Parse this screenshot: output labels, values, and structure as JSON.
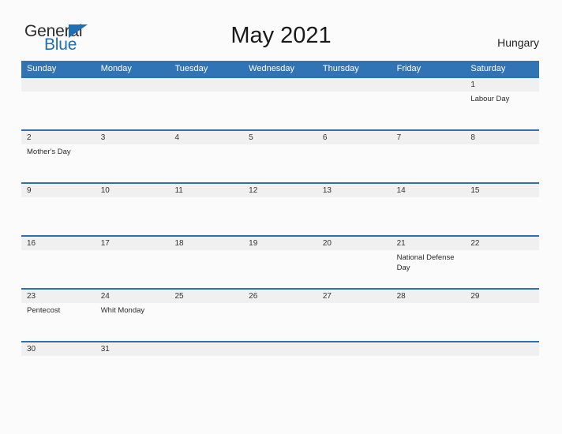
{
  "logo": {
    "word_one": "General",
    "word_two": "Blue",
    "triangle_color": "#1f6fb4"
  },
  "header": {
    "title": "May 2021",
    "country": "Hungary"
  },
  "theme": {
    "header_blue": "#3174b5",
    "row_rule_blue": "#2f6fae",
    "date_band_gray": "#f0f0f0",
    "page_background": "#fbfbfb"
  },
  "calendar": {
    "weekdays": [
      "Sunday",
      "Monday",
      "Tuesday",
      "Wednesday",
      "Thursday",
      "Friday",
      "Saturday"
    ],
    "weeks": [
      {
        "days": [
          {
            "date": "",
            "event": ""
          },
          {
            "date": "",
            "event": ""
          },
          {
            "date": "",
            "event": ""
          },
          {
            "date": "",
            "event": ""
          },
          {
            "date": "",
            "event": ""
          },
          {
            "date": "",
            "event": ""
          },
          {
            "date": "1",
            "event": "Labour Day"
          }
        ]
      },
      {
        "days": [
          {
            "date": "2",
            "event": "Mother's Day"
          },
          {
            "date": "3",
            "event": ""
          },
          {
            "date": "4",
            "event": ""
          },
          {
            "date": "5",
            "event": ""
          },
          {
            "date": "6",
            "event": ""
          },
          {
            "date": "7",
            "event": ""
          },
          {
            "date": "8",
            "event": ""
          }
        ]
      },
      {
        "days": [
          {
            "date": "9",
            "event": ""
          },
          {
            "date": "10",
            "event": ""
          },
          {
            "date": "11",
            "event": ""
          },
          {
            "date": "12",
            "event": ""
          },
          {
            "date": "13",
            "event": ""
          },
          {
            "date": "14",
            "event": ""
          },
          {
            "date": "15",
            "event": ""
          }
        ]
      },
      {
        "days": [
          {
            "date": "16",
            "event": ""
          },
          {
            "date": "17",
            "event": ""
          },
          {
            "date": "18",
            "event": ""
          },
          {
            "date": "19",
            "event": ""
          },
          {
            "date": "20",
            "event": ""
          },
          {
            "date": "21",
            "event": "National Defense Day"
          },
          {
            "date": "22",
            "event": ""
          }
        ]
      },
      {
        "days": [
          {
            "date": "23",
            "event": "Pentecost"
          },
          {
            "date": "24",
            "event": "Whit Monday"
          },
          {
            "date": "25",
            "event": ""
          },
          {
            "date": "26",
            "event": ""
          },
          {
            "date": "27",
            "event": ""
          },
          {
            "date": "28",
            "event": ""
          },
          {
            "date": "29",
            "event": ""
          }
        ]
      },
      {
        "days": [
          {
            "date": "30",
            "event": ""
          },
          {
            "date": "31",
            "event": ""
          },
          {
            "date": "",
            "event": ""
          },
          {
            "date": "",
            "event": ""
          },
          {
            "date": "",
            "event": ""
          },
          {
            "date": "",
            "event": ""
          },
          {
            "date": "",
            "event": ""
          }
        ]
      }
    ]
  }
}
